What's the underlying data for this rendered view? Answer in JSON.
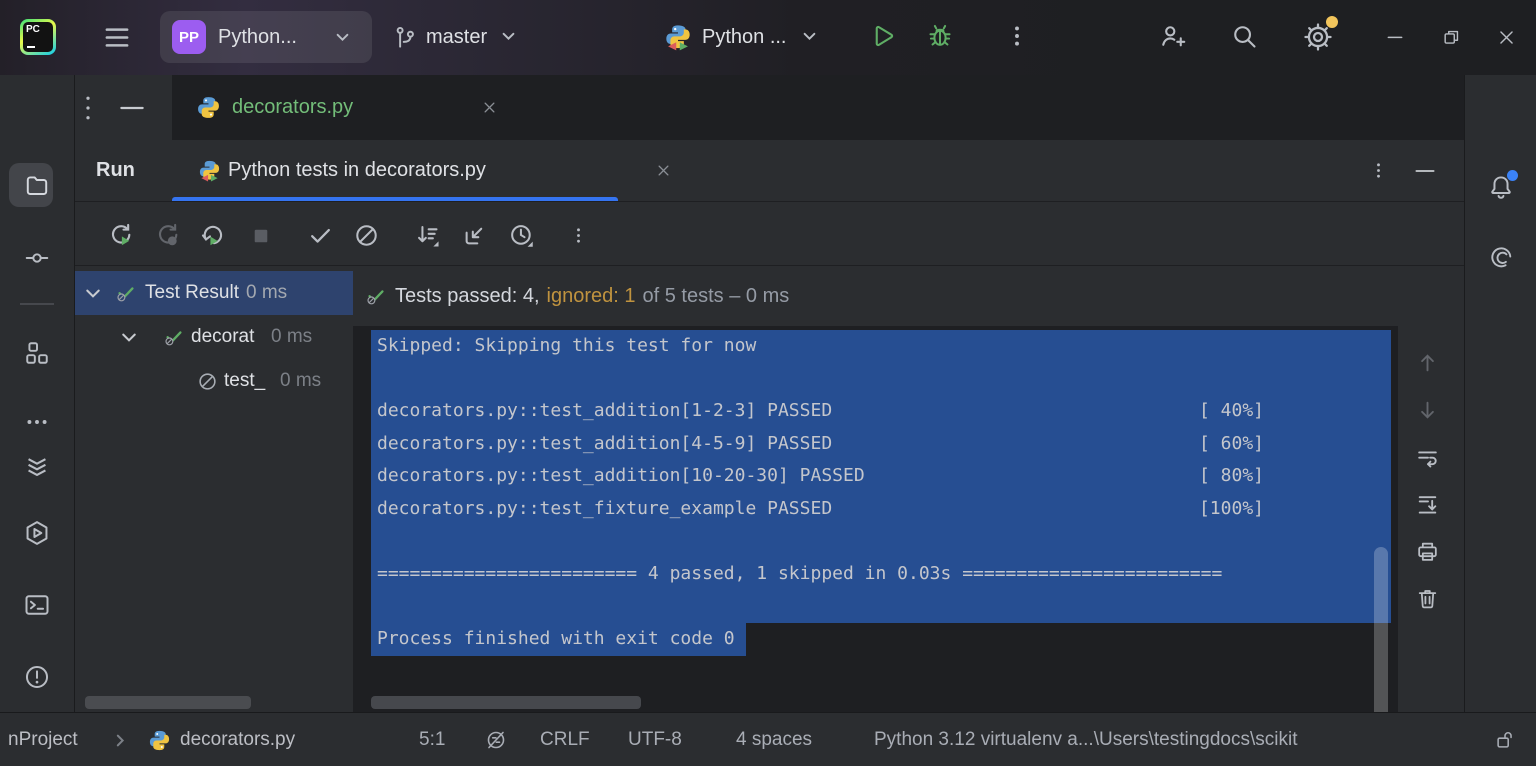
{
  "titlebar": {
    "logo_text": "PC",
    "project_initials": "PP",
    "project_name": "Python...",
    "branch": "master",
    "run_config": "Python ..."
  },
  "editor_tabs": {
    "file_tab": "decorators.py"
  },
  "run_panel": {
    "title": "Run",
    "tab": "Python tests in decorators.py",
    "summary_passed": "Tests passed: 4,",
    "summary_ignored": "ignored: 1",
    "summary_rest": "of 5 tests – 0 ms"
  },
  "test_tree": {
    "rows": [
      {
        "label": "Test Result",
        "time": "0 ms"
      },
      {
        "label": "decorat",
        "time": "0 ms"
      },
      {
        "label": "test_",
        "time": "0 ms"
      }
    ]
  },
  "console": {
    "lines": [
      {
        "text": "Skipped: Skipping this test for now",
        "pct": ""
      },
      {
        "text": "",
        "pct": ""
      },
      {
        "text": "decorators.py::test_addition[1-2-3] PASSED",
        "pct": "[ 40%]"
      },
      {
        "text": "decorators.py::test_addition[4-5-9] PASSED",
        "pct": "[ 60%]"
      },
      {
        "text": "decorators.py::test_addition[10-20-30] PASSED",
        "pct": "[ 80%]"
      },
      {
        "text": "decorators.py::test_fixture_example PASSED",
        "pct": "[100%]"
      },
      {
        "text": "",
        "pct": ""
      },
      {
        "text": "======================== 4 passed, 1 skipped in 0.03s ========================",
        "pct": ""
      },
      {
        "text": "",
        "pct": ""
      },
      {
        "text": "Process finished with exit code 0",
        "pct": ""
      }
    ]
  },
  "statusbar": {
    "breadcrumb_project": "nProject",
    "breadcrumb_file": "decorators.py",
    "caret": "5:1",
    "line_sep": "CRLF",
    "encoding": "UTF-8",
    "indent": "4 spaces",
    "interpreter": "Python 3.12 virtualenv a...\\Users\\testingdocs\\scikit"
  },
  "colors": {
    "accent_blue": "#3574F0",
    "green": "#5FAD65",
    "ignored_amber": "#C0933F",
    "purple_chip": "#9C5DF0",
    "tree_selection": "#2E436E",
    "console_selection": "#264E92",
    "added_file_green": "#73BD79",
    "notification_dot": "#3B82F6",
    "settings_badge": "#F2C55C"
  },
  "icons": [
    "pycharm-logo",
    "hamburger",
    "chevron-down",
    "git-branch",
    "pytest-python",
    "run-play",
    "debug-bug",
    "kebab",
    "add-user",
    "search",
    "settings-gear",
    "window-minimize",
    "window-restore",
    "window-close",
    "project-folder",
    "commit",
    "structure",
    "more-dots",
    "collapse-chevrons",
    "services",
    "terminal",
    "problems",
    "bell",
    "ai-assistant",
    "rerun",
    "rerun-failed",
    "auto-rerun",
    "stop",
    "filter-passed",
    "filter-ignored",
    "sort",
    "navigate-source",
    "history-clock",
    "arrow-up",
    "arrow-down",
    "soft-wrap",
    "scroll-to-end",
    "print",
    "clear-trash",
    "test-passed",
    "test-ignored",
    "highlight-off",
    "unlocked"
  ]
}
